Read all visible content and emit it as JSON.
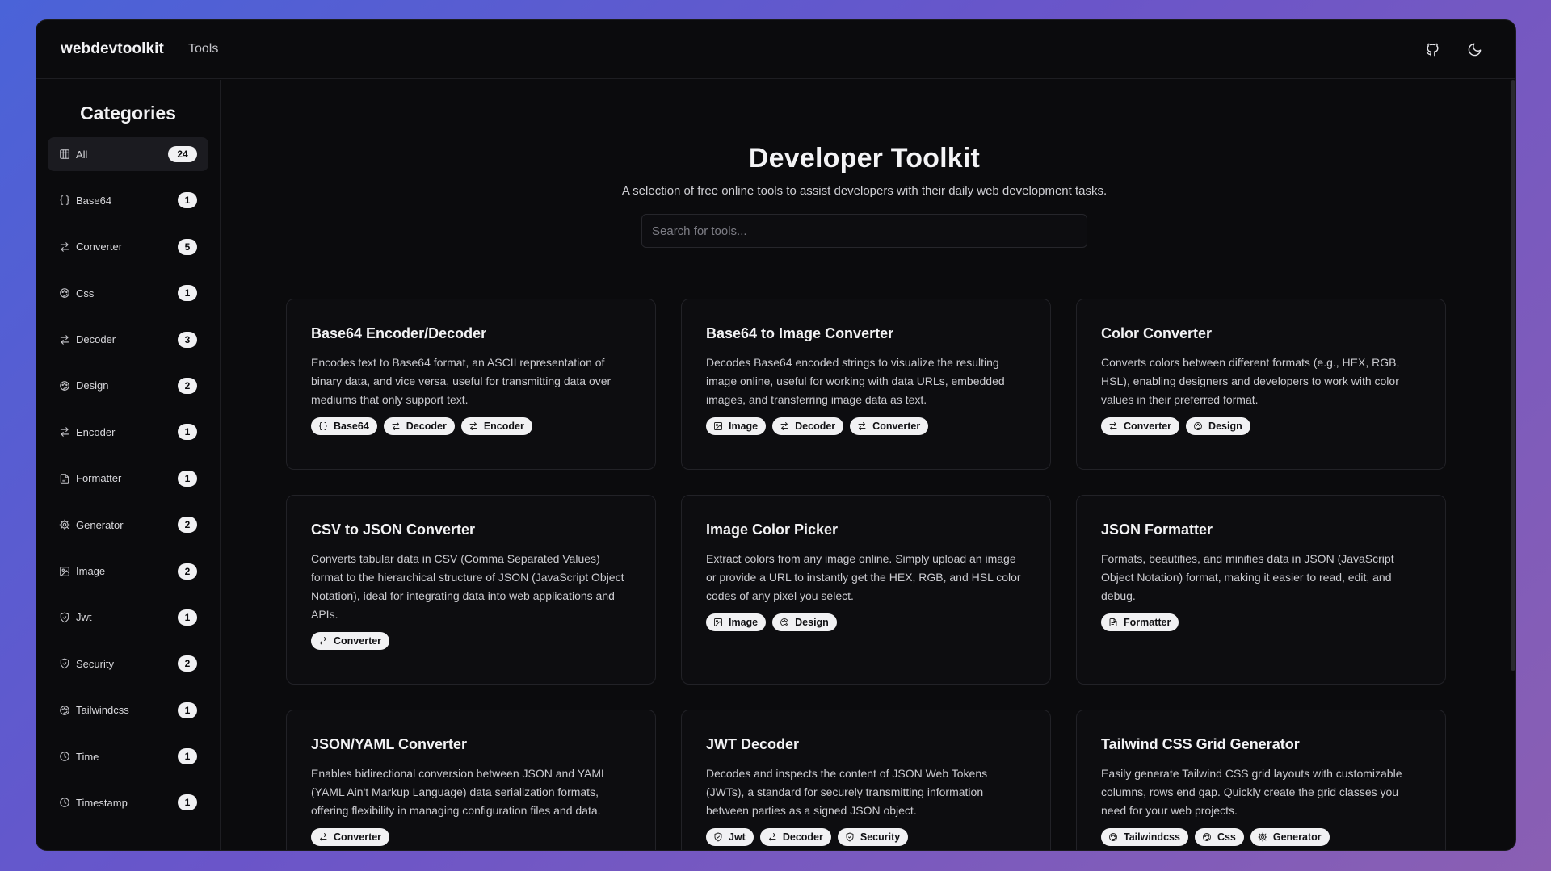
{
  "header": {
    "brand": "webdevtoolkit",
    "nav_tools": "Tools",
    "github_icon": "github-icon",
    "theme_icon": "moon-icon"
  },
  "sidebar": {
    "title": "Categories",
    "items": [
      {
        "label": "All",
        "count": "24",
        "icon": "grid-icon"
      },
      {
        "label": "Base64",
        "count": "1",
        "icon": "braces-icon"
      },
      {
        "label": "Converter",
        "count": "5",
        "icon": "arrows-icon"
      },
      {
        "label": "Css",
        "count": "1",
        "icon": "palette-icon"
      },
      {
        "label": "Decoder",
        "count": "3",
        "icon": "arrows-icon"
      },
      {
        "label": "Design",
        "count": "2",
        "icon": "palette-icon"
      },
      {
        "label": "Encoder",
        "count": "1",
        "icon": "arrows-icon"
      },
      {
        "label": "Formatter",
        "count": "1",
        "icon": "file-icon"
      },
      {
        "label": "Generator",
        "count": "2",
        "icon": "gear-icon"
      },
      {
        "label": "Image",
        "count": "2",
        "icon": "image-icon"
      },
      {
        "label": "Jwt",
        "count": "1",
        "icon": "shield-icon"
      },
      {
        "label": "Security",
        "count": "2",
        "icon": "shield-icon"
      },
      {
        "label": "Tailwindcss",
        "count": "1",
        "icon": "palette-icon"
      },
      {
        "label": "Time",
        "count": "1",
        "icon": "clock-icon"
      },
      {
        "label": "Timestamp",
        "count": "1",
        "icon": "clock-icon"
      }
    ]
  },
  "hero": {
    "title": "Developer Toolkit",
    "subtitle": "A selection of free online tools to assist developers with their daily web development tasks.",
    "search_placeholder": "Search for tools..."
  },
  "cards": [
    {
      "title": "Base64 Encoder/Decoder",
      "desc": "Encodes text to Base64 format, an ASCII representation of binary data, and vice versa, useful for transmitting data over mediums that only support text.",
      "tags": [
        {
          "label": "Base64",
          "icon": "braces-icon"
        },
        {
          "label": "Decoder",
          "icon": "arrows-icon"
        },
        {
          "label": "Encoder",
          "icon": "arrows-icon"
        }
      ]
    },
    {
      "title": "Base64 to Image Converter",
      "desc": "Decodes Base64 encoded strings to visualize the resulting image online, useful for working with data URLs, embedded images, and transferring image data as text.",
      "tags": [
        {
          "label": "Image",
          "icon": "image-icon"
        },
        {
          "label": "Decoder",
          "icon": "arrows-icon"
        },
        {
          "label": "Converter",
          "icon": "arrows-icon"
        }
      ]
    },
    {
      "title": "Color Converter",
      "desc": "Converts colors between different formats (e.g., HEX, RGB, HSL), enabling designers and developers to work with color values in their preferred format.",
      "tags": [
        {
          "label": "Converter",
          "icon": "arrows-icon"
        },
        {
          "label": "Design",
          "icon": "palette-icon"
        }
      ]
    },
    {
      "title": "CSV to JSON Converter",
      "desc": "Converts tabular data in CSV (Comma Separated Values) format to the hierarchical structure of JSON (JavaScript Object Notation), ideal for integrating data into web applications and APIs.",
      "tags": [
        {
          "label": "Converter",
          "icon": "arrows-icon"
        }
      ]
    },
    {
      "title": "Image Color Picker",
      "desc": "Extract colors from any image online. Simply upload an image or provide a URL to instantly get the HEX, RGB, and HSL color codes of any pixel you select.",
      "tags": [
        {
          "label": "Image",
          "icon": "image-icon"
        },
        {
          "label": "Design",
          "icon": "palette-icon"
        }
      ]
    },
    {
      "title": "JSON Formatter",
      "desc": "Formats, beautifies, and minifies data in JSON (JavaScript Object Notation) format, making it easier to read, edit, and debug.",
      "tags": [
        {
          "label": "Formatter",
          "icon": "file-icon"
        }
      ]
    },
    {
      "title": "JSON/YAML Converter",
      "desc": "Enables bidirectional conversion between JSON and YAML (YAML Ain't Markup Language) data serialization formats, offering flexibility in managing configuration files and data.",
      "tags": [
        {
          "label": "Converter",
          "icon": "arrows-icon"
        }
      ]
    },
    {
      "title": "JWT Decoder",
      "desc": "Decodes and inspects the content of JSON Web Tokens (JWTs), a standard for securely transmitting information between parties as a signed JSON object.",
      "tags": [
        {
          "label": "Jwt",
          "icon": "shield-icon"
        },
        {
          "label": "Decoder",
          "icon": "arrows-icon"
        },
        {
          "label": "Security",
          "icon": "shield-icon"
        }
      ]
    },
    {
      "title": "Tailwind CSS Grid Generator",
      "desc": "Easily generate Tailwind CSS grid layouts with customizable columns, rows end gap. Quickly create the grid classes you need for your web projects.",
      "tags": [
        {
          "label": "Tailwindcss",
          "icon": "palette-icon"
        },
        {
          "label": "Css",
          "icon": "palette-icon"
        },
        {
          "label": "Generator",
          "icon": "gear-icon"
        }
      ]
    }
  ]
}
